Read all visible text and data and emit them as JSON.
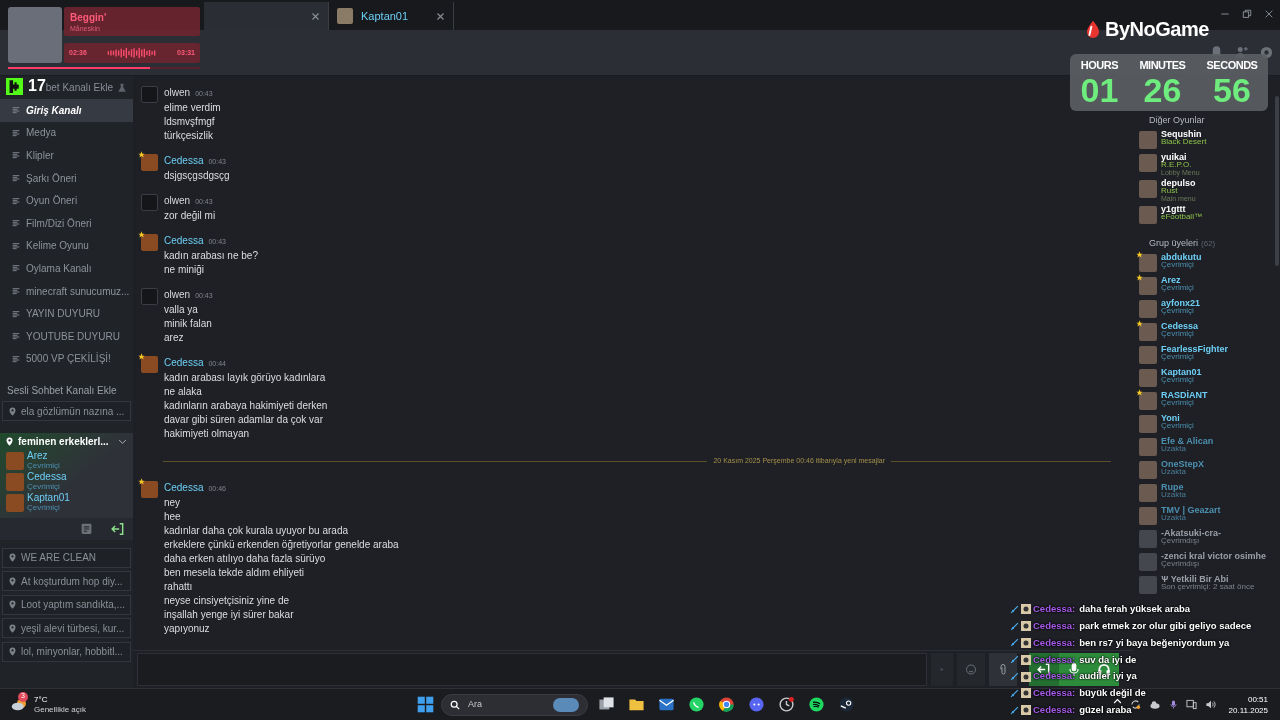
{
  "tabs": [
    {
      "selected": true
    },
    {
      "label": "Kaptan01",
      "selected": false
    }
  ],
  "music_widget": {
    "title": "Beggin'",
    "artist": "Måneskin",
    "elapsed": "02:36",
    "duration": "03:31",
    "level": 0.74
  },
  "kick_badge": {
    "count": "17"
  },
  "brand": {
    "name": "ByNoGame"
  },
  "timer": [
    {
      "label": "HOURS",
      "value": "01"
    },
    {
      "label": "MINUTES",
      "value": "26"
    },
    {
      "label": "SECONDS",
      "value": "56"
    }
  ],
  "sidebar": {
    "text_header": "bet Kanalı Ekle",
    "text_channels": [
      {
        "name": "Giriş Kanalı",
        "selected": true
      },
      {
        "name": "Medya",
        "selected": false
      },
      {
        "name": "Klipler",
        "selected": false
      },
      {
        "name": "Şarkı Öneri",
        "selected": false
      },
      {
        "name": "Oyun Öneri",
        "selected": false
      },
      {
        "name": "Film/Dizi Öneri",
        "selected": false
      },
      {
        "name": "Kelime Oyunu",
        "selected": false
      },
      {
        "name": "Oylama Kanalı",
        "selected": false
      },
      {
        "name": "minecraft sunucumuz...",
        "selected": false
      },
      {
        "name": "YAYIN DUYURU",
        "selected": false
      },
      {
        "name": "YOUTUBE DUYURU",
        "selected": false
      },
      {
        "name": "5000 VP ÇEKİLİŞİ!",
        "selected": false
      }
    ],
    "voice_header": "Sesli Sohbet Kanalı Ekle",
    "voice_channels": [
      {
        "name": "ela gözlümün nazına ...",
        "expanded": false
      },
      {
        "name": "feminen erkeklerl...",
        "expanded": true,
        "members": [
          {
            "name": "Arez",
            "status": "Çevrimiçi"
          },
          {
            "name": "Cedessa",
            "status": "Çevrimiçi"
          },
          {
            "name": "Kaptan01",
            "status": "Çevrimiçi"
          }
        ]
      },
      {
        "name": "WE ARE CLEAN",
        "expanded": false
      },
      {
        "name": "At koşturdum hop diy...",
        "expanded": false
      },
      {
        "name": "Loot yaptım sandıkta,...",
        "expanded": false
      },
      {
        "name": "yeşil alevi türbesi, kur...",
        "expanded": false
      },
      {
        "name": "lol, minyonlar, hobbitl...",
        "expanded": false
      }
    ]
  },
  "chat": [
    {
      "kind": "message",
      "author": "olwen",
      "time": "00:43",
      "starred": false,
      "lines": [
        "elime verdim",
        "ldsmvşfmgf",
        "türkçesizlik"
      ]
    },
    {
      "kind": "message",
      "author": "Cedessa",
      "time": "00:43",
      "starred": true,
      "lines": [
        "dsjgsçgsdgsçg"
      ]
    },
    {
      "kind": "message",
      "author": "olwen",
      "time": "00:43",
      "starred": false,
      "lines": [
        "zor değil mi"
      ]
    },
    {
      "kind": "message",
      "author": "Cedessa",
      "time": "00:43",
      "starred": true,
      "lines": [
        "kadın arabası ne be?",
        "ne miniği"
      ]
    },
    {
      "kind": "message",
      "author": "olwen",
      "time": "00:43",
      "starred": false,
      "lines": [
        "valla ya",
        "minik falan",
        "arez"
      ]
    },
    {
      "kind": "message",
      "author": "Cedessa",
      "time": "00:44",
      "starred": true,
      "lines": [
        "kadın arabası layık görüyo kadınlara",
        "ne alaka",
        "kadınların arabaya hakimiyeti derken",
        "davar gibi süren adamlar da çok var",
        "hakimiyeti olmayan"
      ]
    },
    {
      "kind": "divider",
      "text": "20 Kasım 2025 Perşembe 00:46 itibarıyla yeni mesajlar"
    },
    {
      "kind": "message",
      "author": "Cedessa",
      "time": "00:46",
      "starred": true,
      "lines": [
        "ney",
        "hee",
        "kadınlar daha çok kurala uyuyor bu arada",
        "erkeklere çünkü erkenden öğretiyorlar genelde araba",
        "daha erken atılıyo daha fazla sürüyo",
        "ben mesela tekde aldım ehliyeti",
        "rahattı",
        "neyse cinsiyetçisiniz yine de",
        "inşallah yenge iyi sürer bakar",
        "yapıyonuz"
      ]
    }
  ],
  "members": [
    {
      "title": "Diğer Oyunlar",
      "items": [
        {
          "kind": "ingame",
          "name": "Sequshin",
          "status": "Black Desert",
          "starred": false
        },
        {
          "kind": "ingame",
          "name": "yuikai",
          "status": "R.E.P.O.",
          "detail": "Lobby Menu",
          "starred": false
        },
        {
          "kind": "ingame",
          "name": "depulso",
          "status": "Rust",
          "detail": "Main menu",
          "starred": false
        },
        {
          "kind": "ingame",
          "name": "y1gttt",
          "status": "eFootball™",
          "starred": false
        }
      ]
    },
    {
      "title": "Grup üyeleri",
      "count": "(62)",
      "items": [
        {
          "kind": "online",
          "name": "abdukutu",
          "status": "Çevrimiçi",
          "starred": true
        },
        {
          "kind": "online",
          "name": "Arez",
          "status": "Çevrimiçi",
          "starred": true
        },
        {
          "kind": "online",
          "name": "ayfonx21",
          "status": "Çevrimiçi",
          "starred": false
        },
        {
          "kind": "online",
          "name": "Cedessa",
          "status": "Çevrimiçi",
          "starred": true
        },
        {
          "kind": "online",
          "name": "FearlessFighter",
          "status": "Çevrimiçi",
          "starred": false
        },
        {
          "kind": "online",
          "name": "Kaptan01",
          "status": "Çevrimiçi",
          "starred": false
        },
        {
          "kind": "online",
          "name": "RASDİANT",
          "status": "Çevrimiçi",
          "starred": true
        },
        {
          "kind": "online",
          "name": "Yoni",
          "status": "Çevrimiçi",
          "starred": false
        },
        {
          "kind": "away",
          "name": "Efe & Alican",
          "status": "Uzakta",
          "starred": false
        },
        {
          "kind": "away",
          "name": "OneStepX",
          "status": "Uzakta",
          "starred": false
        },
        {
          "kind": "away",
          "name": "Rupe",
          "status": "Uzakta",
          "starred": false
        },
        {
          "kind": "away",
          "name": "TMV | Geazart",
          "status": "Uzakta",
          "starred": false
        },
        {
          "kind": "offline",
          "name": "-Akatsuki-cra-",
          "status": "Çevrimdışı",
          "starred": false
        },
        {
          "kind": "offline",
          "name": "-zenci kral victor osimhe",
          "status": "Çevrimdışı",
          "starred": false
        },
        {
          "kind": "offline",
          "name": "Ѱ Yetkili Bir Abi",
          "status": "Son çevrimiçi: 2 saat önce",
          "starred": false
        }
      ]
    }
  ],
  "stream_chat": [
    {
      "user": "Cedessa:",
      "text": "daha ferah yüksek araba"
    },
    {
      "user": "Cedessa:",
      "text": "park etmek zor olur gibi geliyo sadece"
    },
    {
      "user": "Cedessa:",
      "text": "ben rs7 yi baya beğeniyordum ya"
    },
    {
      "user": "Cedessa:",
      "text": "suv da iyi de"
    },
    {
      "user": "Cedessa:",
      "text": "audiler iyi ya"
    },
    {
      "user": "Cedessa:",
      "text": "büyük değil de"
    },
    {
      "user": "Cedessa:",
      "text": "güzel araba"
    }
  ],
  "taskbar": {
    "weather_badge": "3",
    "temperature": "7°C",
    "weather": "Genellikle açık",
    "search_placeholder": "Ara",
    "time": "00:51",
    "date": "20.11.2025"
  }
}
